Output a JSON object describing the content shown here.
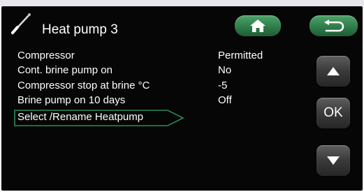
{
  "header": {
    "title": "Heat pump 3",
    "icon": "wrench-icon"
  },
  "nav": {
    "home_icon": "home-icon",
    "back_icon": "back-arrow-icon"
  },
  "settings": [
    {
      "label": "Compressor",
      "value": "Permitted"
    },
    {
      "label": "Cont. brine pump on",
      "value": "No"
    },
    {
      "label": "Compressor stop at brine °C",
      "value": "-5"
    },
    {
      "label": "Brine pump on 10 days",
      "value": "Off"
    }
  ],
  "selected_item": {
    "label": "Select /Rename Heatpump"
  },
  "side_buttons": {
    "up_icon": "arrow-up-icon",
    "ok_label": "OK",
    "down_icon": "arrow-down-icon"
  },
  "colors": {
    "screen_bg": "#060606",
    "accent_green": "#2f7d4a",
    "selection_outline": "#2e8b57"
  }
}
